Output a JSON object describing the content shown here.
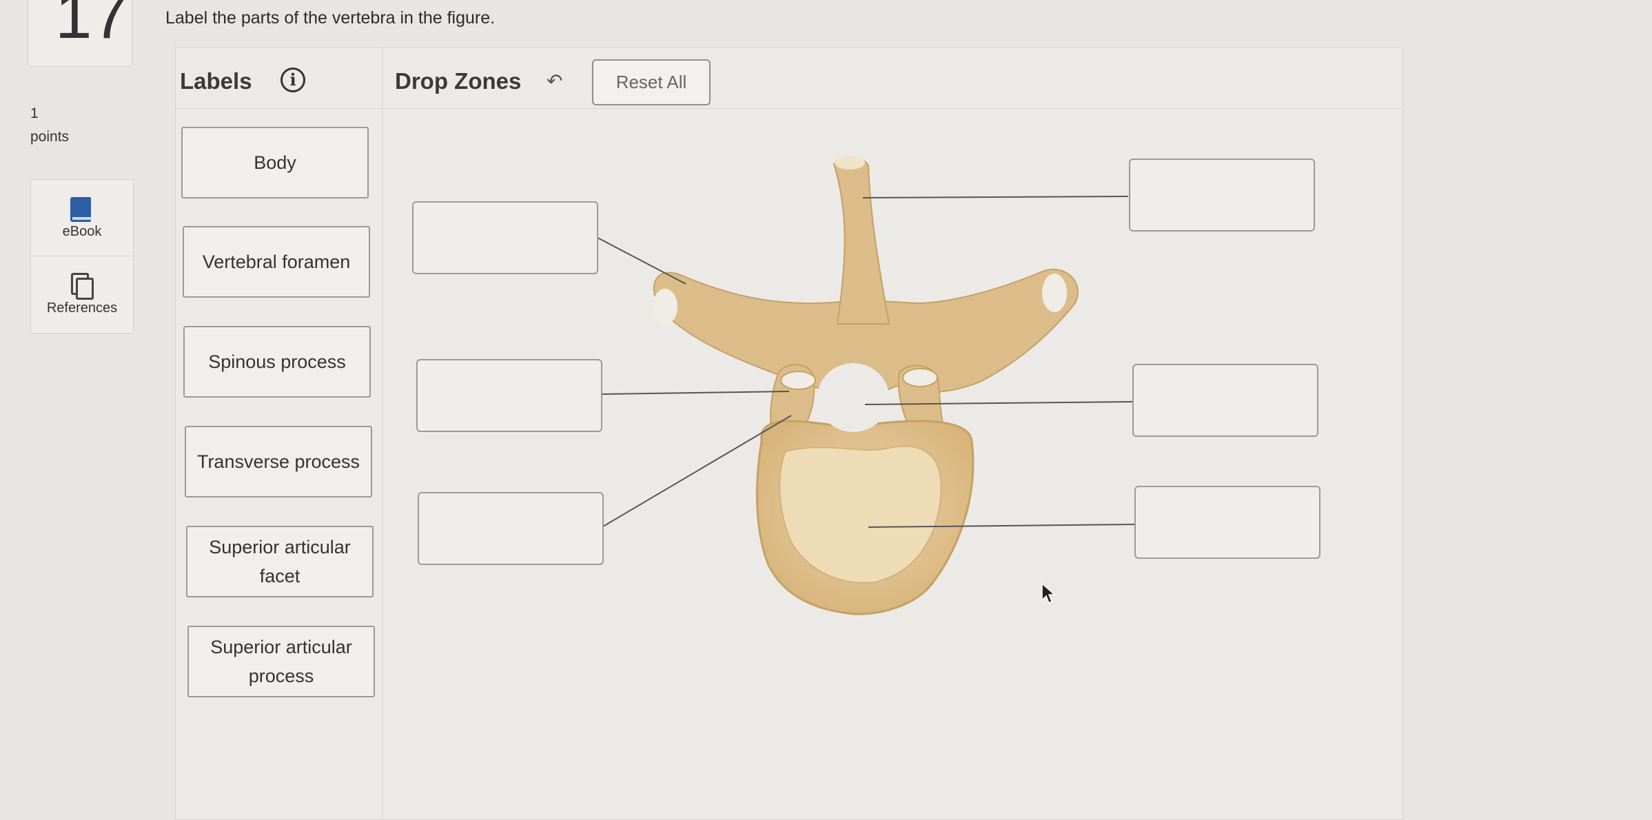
{
  "question_number": "17",
  "points": {
    "value": "1",
    "label": "points"
  },
  "sidebar": [
    {
      "label": "eBook",
      "icon": "ebook-icon"
    },
    {
      "label": "References",
      "icon": "references-icon"
    }
  ],
  "question_text": "Label the parts of the vertebra in the figure.",
  "panel": {
    "labels_header": "Labels",
    "info_glyph": "i",
    "drop_zones_header": "Drop Zones",
    "undo_glyph": "↶",
    "reset_label": "Reset All"
  },
  "labels": [
    "Body",
    "Vertebral foramen",
    "Spinous process",
    "Transverse process",
    "Superior articular facet",
    "Superior articular process"
  ],
  "drop_zones": [
    "",
    "",
    "",
    "",
    "",
    ""
  ],
  "colors": {
    "bone": "#e2c79a",
    "bone_shadow": "#c9a46a",
    "bone_inner": "#efdcb5"
  }
}
